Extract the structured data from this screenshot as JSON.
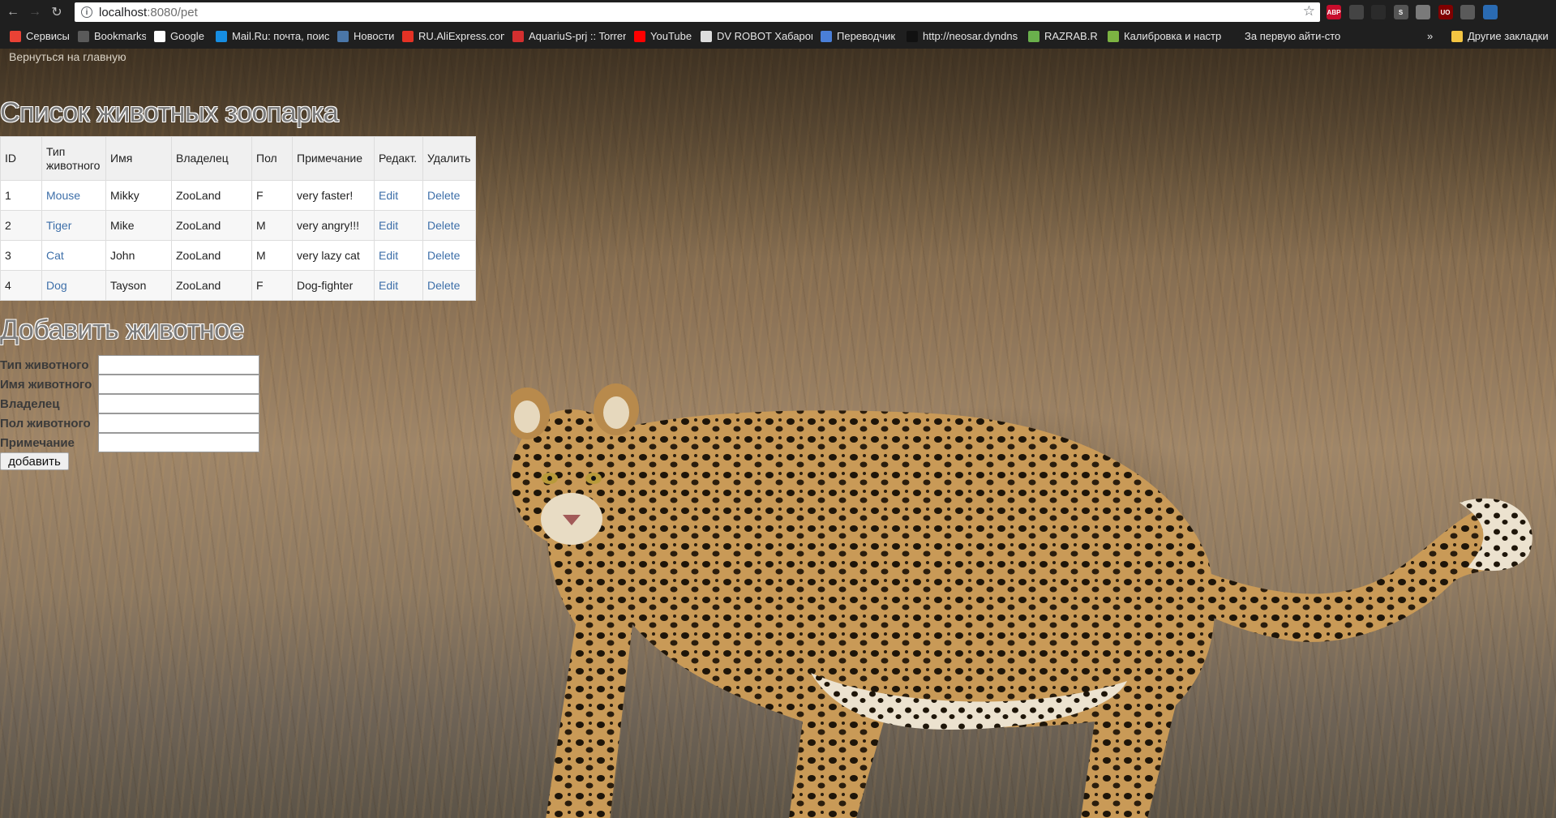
{
  "browser": {
    "url_host": "localhost",
    "url_rest": ":8080/pet",
    "extensions": [
      {
        "icon": "adblock-icon",
        "label": "ABP",
        "color": "#c70d2c"
      },
      {
        "icon": "map-pin-icon",
        "label": "",
        "color": "#444444"
      },
      {
        "icon": "diamond-icon",
        "label": "",
        "color": "#2b2b2b"
      },
      {
        "icon": "s-ext-icon",
        "label": "S",
        "color": "#555555"
      },
      {
        "icon": "page-ext-icon",
        "label": "",
        "color": "#7a7a7a"
      },
      {
        "icon": "ublock-icon",
        "label": "UO",
        "color": "#800000"
      },
      {
        "icon": "puzzle-icon",
        "label": "",
        "color": "#5a5a5a"
      },
      {
        "icon": "globe-icon",
        "label": "",
        "color": "#2a6bb3"
      }
    ]
  },
  "bookmarks": [
    {
      "label": "Сервисы",
      "icon": "apps-grid-icon",
      "color": "#e94235"
    },
    {
      "label": "Bookmarks",
      "icon": "star-icon",
      "color": "#5a5a5a"
    },
    {
      "label": "Google",
      "icon": "google-icon",
      "color": "#ffffff"
    },
    {
      "label": "Mail.Ru: почта, поис",
      "icon": "mailru-icon",
      "color": "#168de2"
    },
    {
      "label": "Новости",
      "icon": "vk-icon",
      "color": "#4a76a8"
    },
    {
      "label": "RU.AliExpress.com",
      "icon": "aliexpress-icon",
      "color": "#e43225"
    },
    {
      "label": "AquariuS-prj :: Torren",
      "icon": "aquarius-icon",
      "color": "#d32f2f"
    },
    {
      "label": "YouTube",
      "icon": "youtube-icon",
      "color": "#ff0000"
    },
    {
      "label": "DV ROBOT Хабаровс",
      "icon": "robot-icon",
      "color": "#dddddd"
    },
    {
      "label": "Переводчик",
      "icon": "translate-icon",
      "color": "#4a7fd8"
    },
    {
      "label": "http://neosar.dyndns",
      "icon": "neosar-icon",
      "color": "#111111"
    },
    {
      "label": "RAZRAB.RU",
      "icon": "cube-icon",
      "color": "#6ab04c"
    },
    {
      "label": "Калибровка и настр",
      "icon": "calibration-icon",
      "color": "#7cb342"
    },
    {
      "label": "За первую айти-сто",
      "icon": "eb-icon",
      "color": "#1f1f1f"
    },
    {
      "label": "Другие закладки",
      "icon": "folder-icon",
      "color": "#f4c542"
    }
  ],
  "page": {
    "back_link": "Вернуться на главную",
    "title": "Список животных зоопарка",
    "table": {
      "headers": {
        "id": "ID",
        "type_line1": "Тип",
        "type_line2": "животного",
        "name": "Имя",
        "owner": "Владелец",
        "sex": "Пол",
        "note": "Примечание",
        "edit": "Редакт.",
        "delete": "Удалить"
      },
      "rows": [
        {
          "id": "1",
          "type": "Mouse",
          "name": "Mikky",
          "owner": "ZooLand",
          "sex": "F",
          "note": "very faster!",
          "edit": "Edit",
          "delete": "Delete"
        },
        {
          "id": "2",
          "type": "Tiger",
          "name": "Mike",
          "owner": "ZooLand",
          "sex": "M",
          "note": "very angry!!!",
          "edit": "Edit",
          "delete": "Delete"
        },
        {
          "id": "3",
          "type": "Cat",
          "name": "John",
          "owner": "ZooLand",
          "sex": "M",
          "note": "very lazy cat",
          "edit": "Edit",
          "delete": "Delete"
        },
        {
          "id": "4",
          "type": "Dog",
          "name": "Tayson",
          "owner": "ZooLand",
          "sex": "F",
          "note": "Dog-fighter",
          "edit": "Edit",
          "delete": "Delete"
        }
      ]
    },
    "form": {
      "title": "Добавить животное",
      "fields": [
        {
          "label": "Тип животного",
          "value": ""
        },
        {
          "label": "Имя животного",
          "value": ""
        },
        {
          "label": "Владелец",
          "value": ""
        },
        {
          "label": "Пол животного",
          "value": ""
        },
        {
          "label": "Примечание",
          "value": ""
        }
      ],
      "submit": "добавить"
    }
  }
}
